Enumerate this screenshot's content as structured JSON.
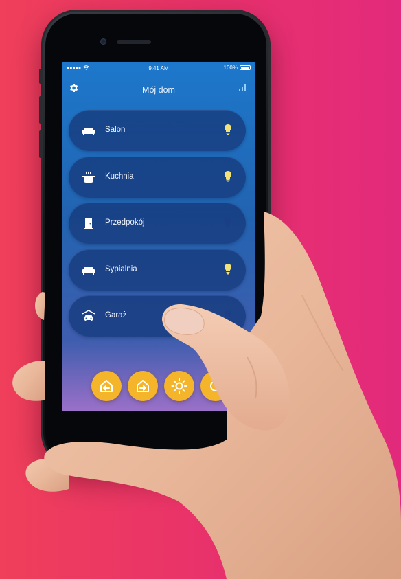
{
  "status_bar": {
    "signal": "●●●●●",
    "time": "9:41 AM",
    "battery": "100%"
  },
  "header": {
    "title": "Mój dom",
    "left_icon": "gear-icon",
    "right_icon": "signal-bars-icon"
  },
  "rooms": [
    {
      "label": "Salon",
      "icon": "sofa-icon",
      "light_on": true
    },
    {
      "label": "Kuchnia",
      "icon": "pot-icon",
      "light_on": true
    },
    {
      "label": "Przedpokój",
      "icon": "door-icon",
      "light_on": false
    },
    {
      "label": "Sypialnia",
      "icon": "sofa-icon",
      "light_on": true
    },
    {
      "label": "Garaż",
      "icon": "car-icon",
      "light_on": false
    }
  ],
  "actions": [
    {
      "icon": "arrive-home-icon"
    },
    {
      "icon": "leave-home-icon"
    },
    {
      "icon": "sun-icon"
    },
    {
      "icon": "power-icon"
    }
  ],
  "colors": {
    "background": "#e8316c",
    "screen_top": "#1d78cc",
    "bulb_on": "#f2e27a",
    "bulb_off": "#1b3f86",
    "action_button": "#f5b52a"
  }
}
